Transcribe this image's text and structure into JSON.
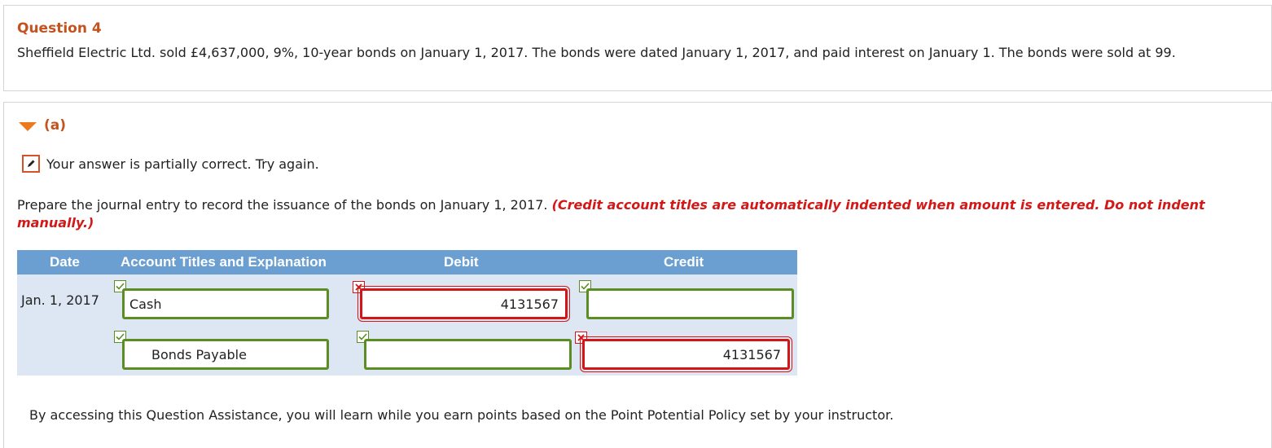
{
  "question": {
    "title": "Question 4",
    "text": "Sheffield Electric Ltd. sold £4,637,000, 9%, 10-year bonds on January 1, 2017. The bonds were dated January 1, 2017, and paid interest on January 1. The bonds were sold at 99."
  },
  "part": {
    "label": "(a)",
    "feedback": "Your answer is partially correct.  Try again.",
    "instruction_main": "Prepare the journal entry to record the issuance of the bonds on January 1, 2017. ",
    "instruction_note": "(Credit account titles are automatically indented when amount is entered. Do not indent manually.)"
  },
  "journal": {
    "headers": {
      "date": "Date",
      "account": "Account Titles and Explanation",
      "debit": "Debit",
      "credit": "Credit"
    },
    "rows": [
      {
        "date": "Jan. 1, 2017",
        "account": "Cash",
        "account_status": "correct",
        "debit": "4131567",
        "debit_status": "incorrect",
        "credit": "",
        "credit_status": "correct"
      },
      {
        "date": "",
        "account": "Bonds Payable",
        "account_status": "correct",
        "debit": "",
        "debit_status": "correct",
        "credit": "4131567",
        "credit_status": "incorrect"
      }
    ]
  },
  "footer": "By accessing this Question Assistance, you will learn while you earn points based on the Point Potential Policy set by your instructor.",
  "colors": {
    "accent": "#c4521e",
    "header_blue": "#6b9fd1",
    "correct_green": "#5b8e22",
    "error_red": "#d51515"
  }
}
